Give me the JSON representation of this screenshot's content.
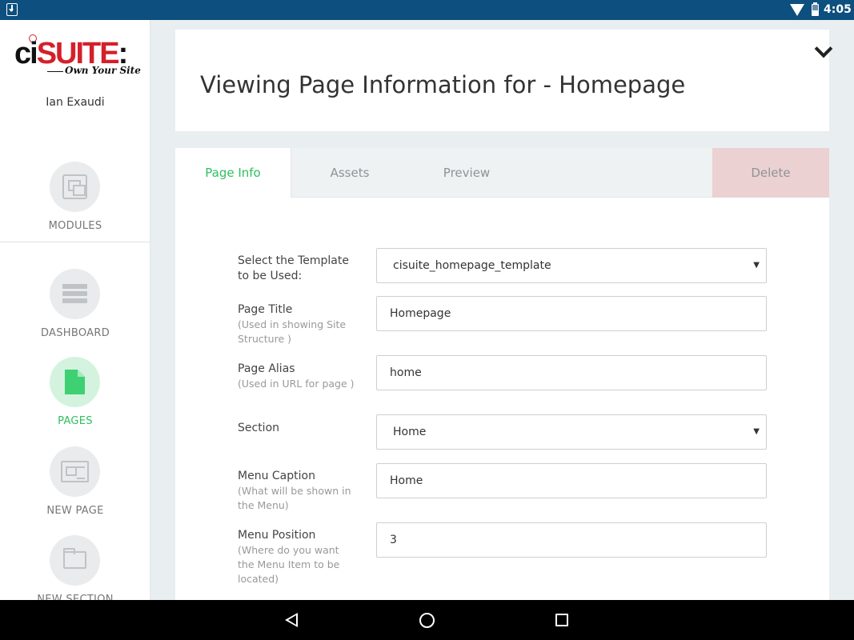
{
  "status_bar": {
    "time": "4:05"
  },
  "sidebar": {
    "logo": {
      "prefix": "ci",
      "brand": "SUITE",
      "colon": ":",
      "tagline": "Own Your Site"
    },
    "username": "Ian Exaudi",
    "items": [
      {
        "label": "MODULES",
        "icon": "modules-icon"
      },
      {
        "label": "DASHBOARD",
        "icon": "dashboard-icon"
      },
      {
        "label": "PAGES",
        "icon": "page-icon",
        "active": true
      },
      {
        "label": "NEW PAGE",
        "icon": "newspaper-icon"
      },
      {
        "label": "NEW SECTION",
        "icon": "folder-icon"
      }
    ]
  },
  "header": {
    "title": "Viewing Page Information for - Homepage"
  },
  "tabs": [
    {
      "label": "Page Info",
      "active": true
    },
    {
      "label": "Assets"
    },
    {
      "label": "Preview"
    },
    {
      "label": "Delete"
    }
  ],
  "form": {
    "template": {
      "label": "Select the Template to be Used:",
      "value": "cisuite_homepage_template"
    },
    "page_title": {
      "label": "Page Title",
      "hint": "(Used in showing Site Structure )",
      "value": "Homepage"
    },
    "page_alias": {
      "label": "Page Alias",
      "hint": "(Used in URL for page )",
      "value": "home"
    },
    "section": {
      "label": "Section",
      "value": "Home"
    },
    "menu_caption": {
      "label": "Menu Caption",
      "hint": "(What will be shown in the Menu)",
      "value": "Home"
    },
    "menu_position": {
      "label": "Menu Position",
      "hint": "(Where do you want the Menu Item to be located)",
      "value": "3"
    }
  },
  "colors": {
    "accent": "#2ebf5f",
    "brand_red": "#d4202a",
    "status_bar": "#0d4f7e",
    "delete_tab": "#ecd1d2"
  }
}
